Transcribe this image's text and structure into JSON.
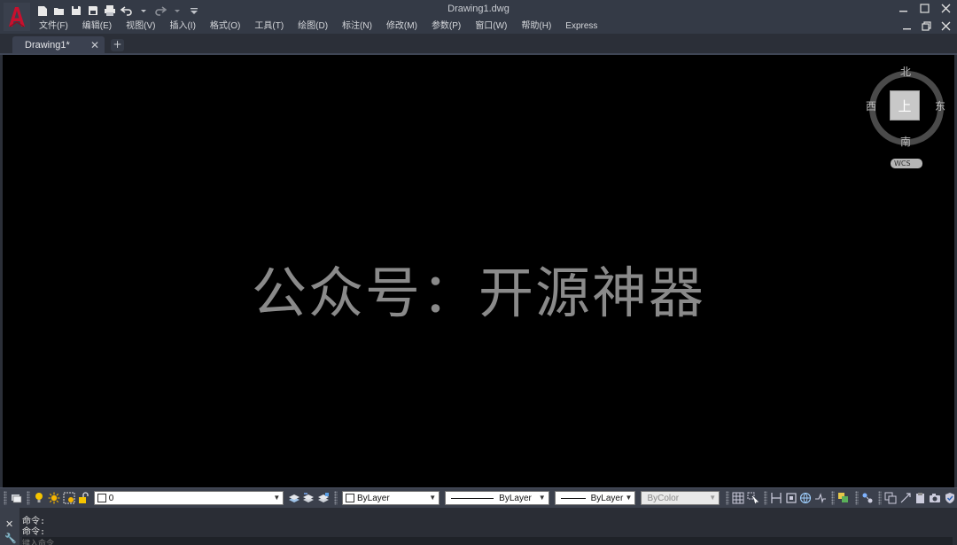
{
  "window": {
    "title": "Drawing1.dwg"
  },
  "menu": [
    "文件(F)",
    "编辑(E)",
    "视图(V)",
    "插入(I)",
    "格式(O)",
    "工具(T)",
    "绘图(D)",
    "标注(N)",
    "修改(M)",
    "参数(P)",
    "窗口(W)",
    "帮助(H)",
    "Express"
  ],
  "tabs": {
    "active": "Drawing1*",
    "close": "✕",
    "new": "+"
  },
  "canvas": {
    "watermark": "公众号：开源神器"
  },
  "viewcube": {
    "north": "北",
    "south": "南",
    "west": "西",
    "east": "东",
    "face": "上",
    "ucs": "WCS"
  },
  "properties": {
    "layer": "0",
    "color": "ByLayer",
    "linetype": "ByLayer",
    "lineweight": "ByLayer",
    "plotstyle": "ByColor"
  },
  "command": {
    "line1": "命令:",
    "line2": "命令:",
    "placeholder": "键入命令"
  },
  "colors": {
    "logo_red": "#c8102e",
    "canvas": "#000000",
    "chrome": "#343a46"
  }
}
